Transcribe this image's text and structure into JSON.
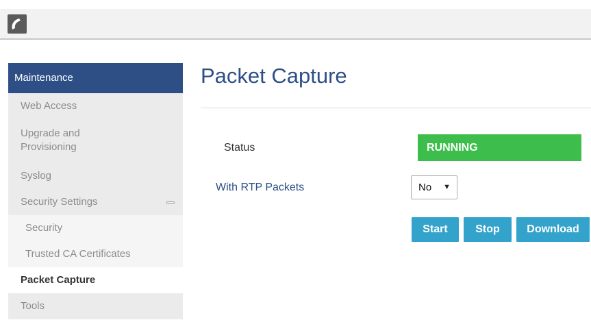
{
  "header": {
    "logo_icon": "phone-handset-icon"
  },
  "sidebar": {
    "section_title": "Maintenance",
    "items": [
      {
        "label": "Web Access"
      },
      {
        "label": "Upgrade and Provisioning",
        "line1": "Upgrade and",
        "line2": "Provisioning"
      },
      {
        "label": "Syslog"
      },
      {
        "label": "Security Settings",
        "expanded": true
      },
      {
        "label": "Security"
      },
      {
        "label": "Trusted CA Certificates"
      },
      {
        "label": "Packet Capture",
        "active": true
      },
      {
        "label": "Tools"
      }
    ]
  },
  "main": {
    "title": "Packet Capture",
    "status_label": "Status",
    "status_value": "RUNNING",
    "status_color": "#3dbd4b",
    "rtp_label": "With RTP Packets",
    "rtp_selected": "No",
    "buttons": {
      "start": "Start",
      "stop": "Stop",
      "download": "Download"
    }
  },
  "colors": {
    "brand": "#2d4f86",
    "button": "#34a3cc"
  }
}
